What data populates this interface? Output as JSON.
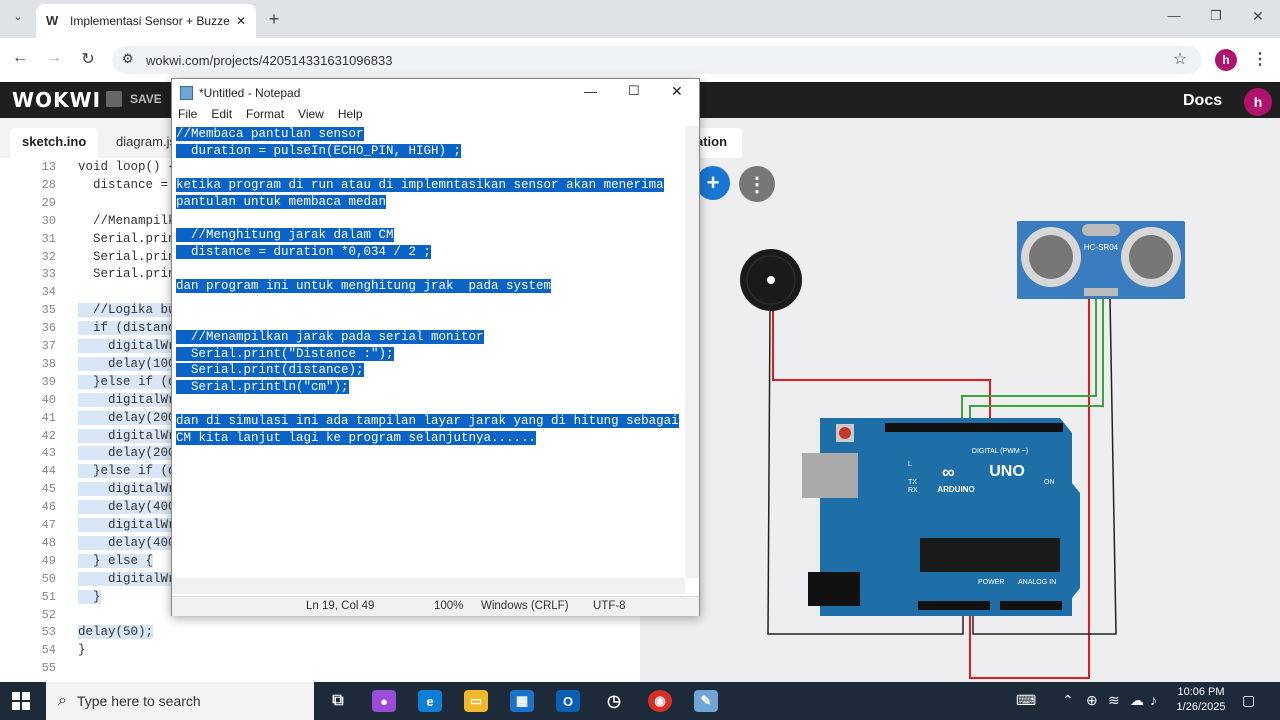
{
  "browser": {
    "tab_title": "Implementasi Sensor + Buzzer",
    "tab_favicon": "W",
    "new_tab": "+",
    "url": "wokwi.com/projects/420514331631096833",
    "window_controls": [
      "—",
      "❐",
      "✕"
    ],
    "profile_initial": "h"
  },
  "wokwi": {
    "logo": "WOKWI",
    "save_label": "SAVE",
    "docs_label": "Docs",
    "profile_initial": "h",
    "editor_tabs": [
      "sketch.ino",
      "diagram.js"
    ],
    "sim_tab_fragment": "ation",
    "plus_button": "+",
    "more_button": "⋮"
  },
  "editor": {
    "lines": [
      {
        "num": "13",
        "code": "void loop() {",
        "sel": false
      },
      {
        "num": "28",
        "code": "  distance = ",
        "sel": false
      },
      {
        "num": "29",
        "code": "",
        "sel": false
      },
      {
        "num": "30",
        "code": "  //Menampilk",
        "sel": false
      },
      {
        "num": "31",
        "code": "  Serial.prin",
        "sel": false
      },
      {
        "num": "32",
        "code": "  Serial.prin",
        "sel": false
      },
      {
        "num": "33",
        "code": "  Serial.prin",
        "sel": false
      },
      {
        "num": "34",
        "code": "",
        "sel": false
      },
      {
        "num": "35",
        "code": "  //Logika bu",
        "sel": true
      },
      {
        "num": "36",
        "code": "  if (distanc",
        "sel": true
      },
      {
        "num": "37",
        "code": "    digitalWr",
        "sel": true
      },
      {
        "num": "38",
        "code": "    delay(100",
        "sel": true
      },
      {
        "num": "39",
        "code": "  }else if (d",
        "sel": true
      },
      {
        "num": "40",
        "code": "    digitalWr",
        "sel": true
      },
      {
        "num": "41",
        "code": "    delay(200",
        "sel": true
      },
      {
        "num": "42",
        "code": "    digitalWr",
        "sel": true
      },
      {
        "num": "43",
        "code": "    delay(200",
        "sel": true
      },
      {
        "num": "44",
        "code": "  }else if (d",
        "sel": true
      },
      {
        "num": "45",
        "code": "    digitalWr",
        "sel": true
      },
      {
        "num": "46",
        "code": "    delay(400",
        "sel": true
      },
      {
        "num": "47",
        "code": "    digitalWr",
        "sel": true
      },
      {
        "num": "48",
        "code": "    delay(400",
        "sel": true
      },
      {
        "num": "49",
        "code": "  } else {",
        "sel": true
      },
      {
        "num": "50",
        "code": "    digitalWr",
        "sel": true
      },
      {
        "num": "51",
        "code": "  }",
        "sel": true
      },
      {
        "num": "52",
        "code": "",
        "sel": true
      },
      {
        "num": "53",
        "code": "delay(50);",
        "sel": true
      },
      {
        "num": "54",
        "code": "}",
        "sel": false
      },
      {
        "num": "55",
        "code": "",
        "sel": false
      }
    ]
  },
  "notepad": {
    "title": "*Untitled - Notepad",
    "menu": [
      "File",
      "Edit",
      "Format",
      "View",
      "Help"
    ],
    "lines": [
      "//Membaca pantulan sensor",
      "  duration = pulseIn(ECHO_PIN, HIGH) ;",
      "",
      "ketika program di run atau di implemntasikan sensor akan menerima",
      "pantulan untuk membaca medan",
      "",
      "  //Menghitung jarak dalam CM",
      "  distance = duration *0,034 / 2 ;",
      "",
      "dan program ini untuk menghitung jrak  pada system",
      "",
      "",
      "  //Menampilkan jarak pada serial monitor",
      "  Serial.print(\"Distance :\");",
      "  Serial.print(distance);",
      "  Serial.println(\"cm\");",
      "",
      "dan di simulasi ini ada tampilan layar jarak yang di hitung sebagai",
      "CM kita lanjut lagi ke program selanjutnya......"
    ],
    "status": {
      "position": "Ln 19, Col 49",
      "zoom": "100%",
      "line_ending": "Windows (CRLF)",
      "encoding": "UTF-8"
    }
  },
  "circuit": {
    "sensor_label": "HC-SR04",
    "board_label": "UNO",
    "board_brand": "ARDUINO",
    "digital_label": "DIGITAL (PWM ~)",
    "power_label": "POWER",
    "analog_label": "ANALOG IN",
    "on_label": "ON",
    "tx_label": "TX",
    "rx_label": "RX",
    "l_label": "L"
  },
  "taskbar": {
    "search_placeholder": "Type here to search",
    "time": "10:06 PM",
    "date": "1/26/2025"
  },
  "colors": {
    "wokwi_header": "#1f1f1f",
    "selection": "#0a64c8",
    "arduino_board": "#1e6fa8",
    "sensor_board": "#3a7cc0",
    "wire_red": "#e01b1b",
    "wire_green": "#3aa53a",
    "taskbar": "#1c2a3a"
  }
}
